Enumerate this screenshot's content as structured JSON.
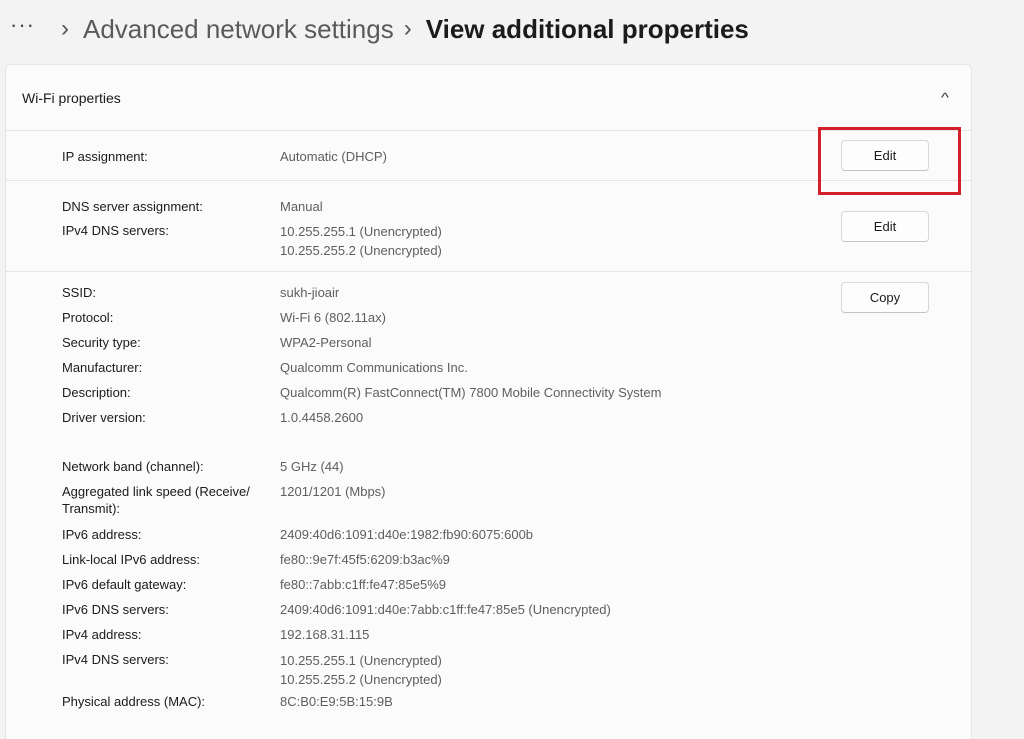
{
  "breadcrumb": {
    "more": "···",
    "parent": "Advanced network settings",
    "current": "View additional properties"
  },
  "card": {
    "title": "Wi-Fi properties"
  },
  "ip_section": {
    "label": "IP assignment:",
    "value": "Automatic (DHCP)",
    "button": "Edit"
  },
  "dns_section": {
    "assignment_label": "DNS server assignment:",
    "assignment_value": "Manual",
    "ipv4_label": "IPv4 DNS servers:",
    "ipv4_value_1": "10.255.255.1 (Unencrypted)",
    "ipv4_value_2": "10.255.255.2 (Unencrypted)",
    "button": "Edit"
  },
  "props_section": {
    "button": "Copy",
    "ssid": {
      "label": "SSID:",
      "value": "sukh-jioair"
    },
    "protocol": {
      "label": "Protocol:",
      "value": "Wi-Fi 6 (802.11ax)"
    },
    "security": {
      "label": "Security type:",
      "value": "WPA2-Personal"
    },
    "manufacturer": {
      "label": "Manufacturer:",
      "value": "Qualcomm Communications Inc."
    },
    "description": {
      "label": "Description:",
      "value": "Qualcomm(R) FastConnect(TM) 7800 Mobile Connectivity System"
    },
    "driver": {
      "label": "Driver version:",
      "value": "1.0.4458.2600"
    },
    "band": {
      "label": "Network band (channel):",
      "value": "5 GHz (44)"
    },
    "link_speed": {
      "label_1": "Aggregated link speed (Receive/",
      "label_2": "Transmit):",
      "value": "1201/1201 (Mbps)"
    },
    "ipv6": {
      "label": "IPv6 address:",
      "value": "2409:40d6:1091:d40e:1982:fb90:6075:600b"
    },
    "link_local": {
      "label": "Link-local IPv6 address:",
      "value": "fe80::9e7f:45f5:6209:b3ac%9"
    },
    "ipv6_gateway": {
      "label": "IPv6 default gateway:",
      "value": "fe80::7abb:c1ff:fe47:85e5%9"
    },
    "ipv6_dns": {
      "label": "IPv6 DNS servers:",
      "value": "2409:40d6:1091:d40e:7abb:c1ff:fe47:85e5 (Unencrypted)"
    },
    "ipv4": {
      "label": "IPv4 address:",
      "value": "192.168.31.115"
    },
    "ipv4_dns": {
      "label": "IPv4 DNS servers:",
      "value_1": "10.255.255.1 (Unencrypted)",
      "value_2": "10.255.255.2 (Unencrypted)"
    },
    "mac": {
      "label": "Physical address (MAC):",
      "value": "8C:B0:E9:5B:15:9B"
    }
  },
  "colors": {
    "highlight": "#d4202a",
    "background": "#f3f3f3",
    "card": "#fbfbfb"
  }
}
